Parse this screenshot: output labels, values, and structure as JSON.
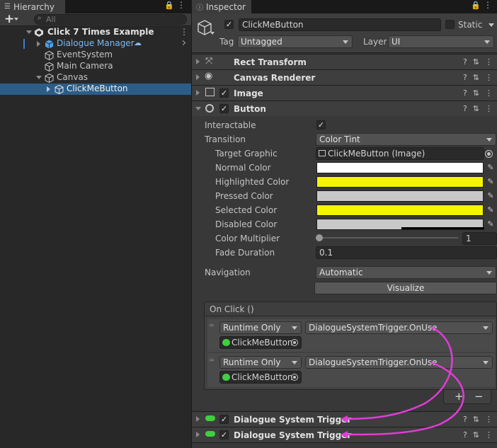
{
  "hierarchy": {
    "tab_label": "Hierarchy",
    "add_label": "+",
    "search_placeholder": "All",
    "scene_name": "Click 7 Times Example",
    "items": [
      {
        "label": "Dialogue Manager"
      },
      {
        "label": "EventSystem"
      },
      {
        "label": "Main Camera"
      },
      {
        "label": "Canvas"
      },
      {
        "label": "ClickMeButton"
      }
    ]
  },
  "inspector": {
    "tab_label": "Inspector",
    "object_name": "ClickMeButton",
    "static_label": "Static",
    "tag_label": "Tag",
    "tag_value": "Untagged",
    "layer_label": "Layer",
    "layer_value": "UI",
    "components": [
      {
        "title": "Rect Transform"
      },
      {
        "title": "Canvas Renderer"
      },
      {
        "title": "Image"
      },
      {
        "title": "Button"
      },
      {
        "title": "Dialogue System Trigger"
      },
      {
        "title": "Dialogue System Trigger"
      }
    ],
    "button": {
      "interactable_label": "Interactable",
      "transition_label": "Transition",
      "transition_value": "Color Tint",
      "target_graphic_label": "Target Graphic",
      "target_graphic_value": "ClickMeButton (Image)",
      "normal_color_label": "Normal Color",
      "highlighted_color_label": "Highlighted Color",
      "pressed_color_label": "Pressed Color",
      "selected_color_label": "Selected Color",
      "disabled_color_label": "Disabled Color",
      "color_multiplier_label": "Color Multiplier",
      "color_multiplier_value": "1",
      "color_multiplier_fraction": 0,
      "fade_duration_label": "Fade Duration",
      "fade_duration_value": "0.1",
      "navigation_label": "Navigation",
      "navigation_value": "Automatic",
      "visualize_label": "Visualize",
      "colors": {
        "normal": "#FFFFFF",
        "highlighted": "#F5F500",
        "pressed": "#C8C8C8",
        "selected": "#F5F500",
        "disabled": "#C8C8C8"
      }
    },
    "on_click": {
      "header": "On Click ()",
      "entries": [
        {
          "mode": "Runtime Only",
          "function": "DialogueSystemTrigger.OnUse",
          "object": "ClickMeButton"
        },
        {
          "mode": "Runtime Only",
          "function": "DialogueSystemTrigger.OnUse",
          "object": "ClickMeButton"
        }
      ],
      "add_label": "+",
      "remove_label": "−"
    },
    "arrow_color": "#E23BD9"
  }
}
